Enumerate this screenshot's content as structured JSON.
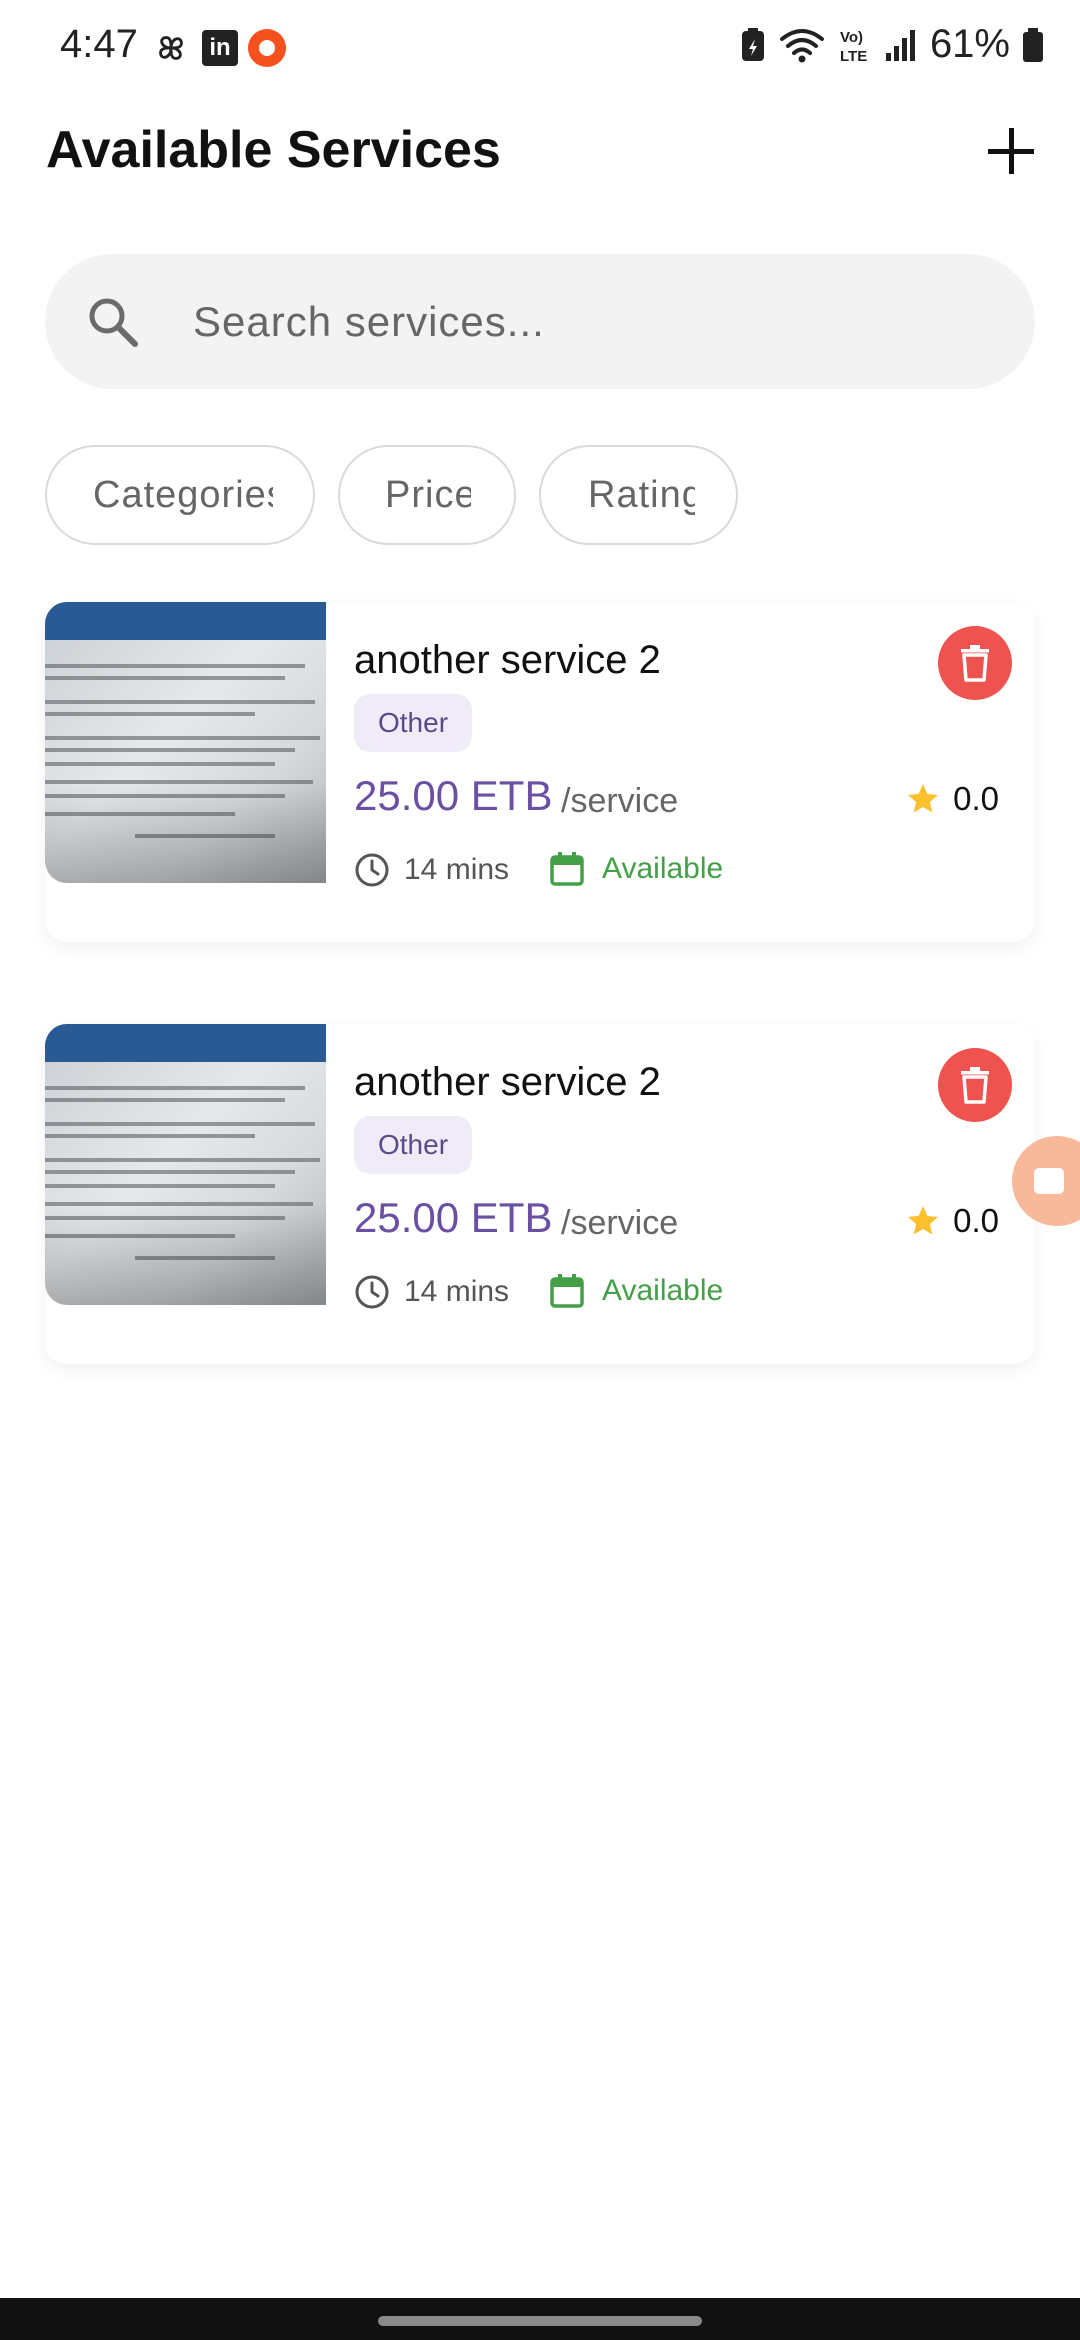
{
  "status_bar": {
    "time": "4:47",
    "battery": "61%",
    "left_icons": [
      "pinwheel-icon",
      "linkedin-icon",
      "screen-recorder-icon"
    ],
    "right_icons": [
      "battery-saver-icon",
      "wifi-icon",
      "volte-icon",
      "signal-icon",
      "battery-icon"
    ]
  },
  "header": {
    "title": "Available Services",
    "add_icon": "plus-icon"
  },
  "search": {
    "placeholder": "Search services...",
    "value": "",
    "icon": "search-icon"
  },
  "filters": [
    {
      "label": "Categories"
    },
    {
      "label": "Price"
    },
    {
      "label": "Rating"
    }
  ],
  "services": [
    {
      "name": "another service 2",
      "category": "Other",
      "price": "25.00 ETB",
      "unit": "/service",
      "rating": "0.0",
      "duration": "14 mins",
      "availability": "Available"
    },
    {
      "name": "another service 2",
      "category": "Other",
      "price": "25.00 ETB",
      "unit": "/service",
      "rating": "0.0",
      "duration": "14 mins",
      "availability": "Available"
    }
  ],
  "colors": {
    "accent": "#6a4fa3",
    "delete": "#ef5350",
    "available": "#43a047",
    "star": "#fbc02d",
    "badge_bg": "#efecf7"
  }
}
